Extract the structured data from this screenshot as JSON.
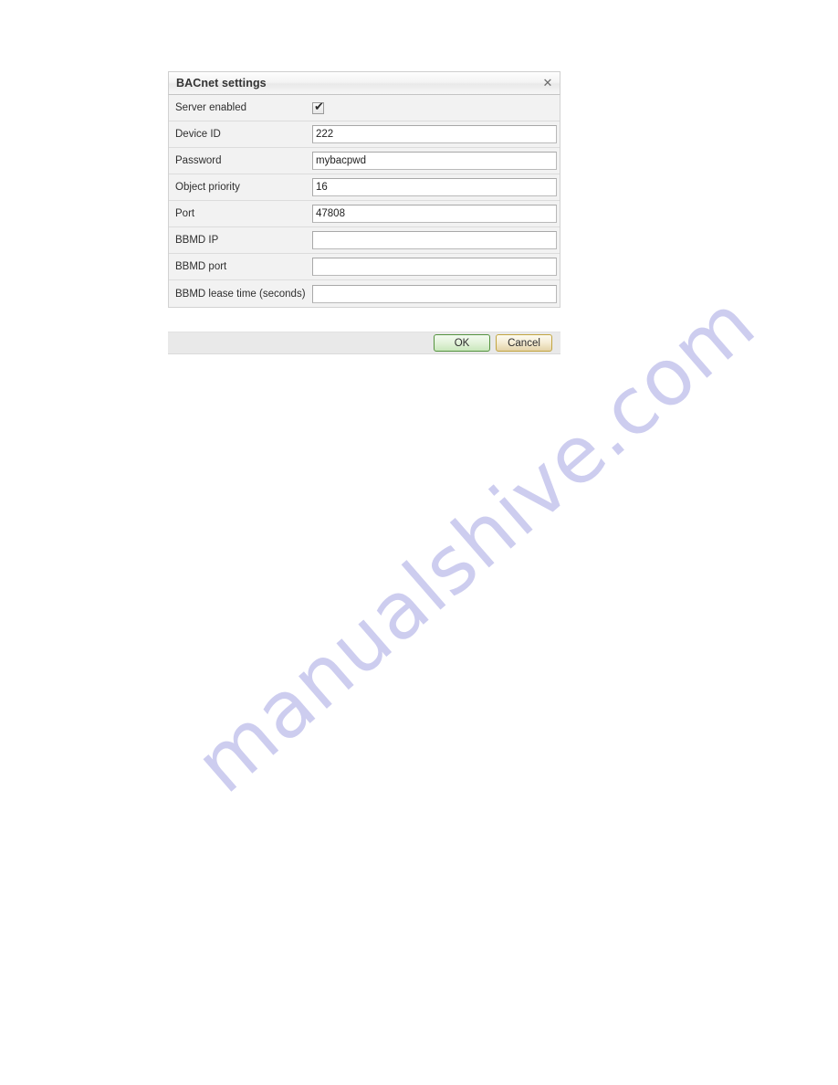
{
  "watermark": {
    "text": "manualshive.com"
  },
  "dialog": {
    "title": "BACnet settings",
    "close_icon": "close-icon",
    "close_glyph": "✕",
    "fields": [
      {
        "label": "Server enabled",
        "type": "checkbox",
        "checked": true,
        "check_glyph": "✔"
      },
      {
        "label": "Device ID",
        "type": "text",
        "value": "222",
        "placeholder": ""
      },
      {
        "label": "Password",
        "type": "text",
        "value": "mybacpwd",
        "placeholder": ""
      },
      {
        "label": "Object priority",
        "type": "text",
        "value": "16",
        "placeholder": ""
      },
      {
        "label": "Port",
        "type": "text",
        "value": "47808",
        "placeholder": ""
      },
      {
        "label": "BBMD IP",
        "type": "text",
        "value": "",
        "placeholder": ""
      },
      {
        "label": "BBMD port",
        "type": "text",
        "value": "",
        "placeholder": ""
      },
      {
        "label": "BBMD lease time (seconds)",
        "type": "text",
        "value": "",
        "placeholder": ""
      }
    ],
    "footer": {
      "ok_label": "OK",
      "cancel_label": "Cancel"
    }
  },
  "colors": {
    "ok_border": "#55933f",
    "cancel_border": "#c2a541",
    "watermark": "#c9c9ee",
    "title_text": "#333333",
    "row_bg": "#f2f2f2",
    "footer_bg": "#e9e9e9"
  }
}
